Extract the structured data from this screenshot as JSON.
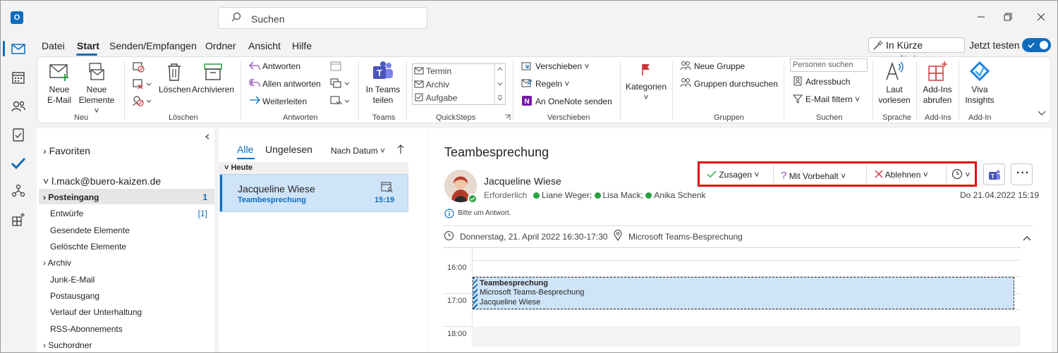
{
  "search": {
    "placeholder": "Suchen"
  },
  "menu": {
    "items": [
      "Datei",
      "Start",
      "Senden/Empfangen",
      "Ordner",
      "Ansicht",
      "Hilfe"
    ],
    "coming_soon": "In Kürze verfügbar",
    "try_now": "Jetzt testen"
  },
  "ribbon": {
    "new_email": [
      "Neue",
      "E-Mail"
    ],
    "new_items": [
      "Neue",
      "Elemente ˅"
    ],
    "group_new": "Neu",
    "delete": "Löschen",
    "archive": "Archivieren",
    "group_delete": "Löschen",
    "reply": "Antworten",
    "reply_all": "Allen antworten",
    "forward": "Weiterleiten",
    "group_reply": "Antworten",
    "teams_share": [
      "In Teams",
      "teilen"
    ],
    "group_teams": "Teams",
    "quicksteps": [
      "Termin",
      "Archiv",
      "Aufgabe"
    ],
    "group_quicksteps": "QuickSteps",
    "move": "Verschieben",
    "rules": "Regeln",
    "onenote": "An OneNote senden",
    "group_move": "Verschieben",
    "categories": "Kategorien",
    "new_group": "Neue Gruppe",
    "browse_groups": "Gruppen durchsuchen",
    "group_groups": "Gruppen",
    "people_search": "Personen suchen",
    "address_book": "Adressbuch",
    "filter_email": "E-Mail filtern",
    "group_search": "Suchen",
    "read_aloud": [
      "Laut",
      "vorlesen"
    ],
    "group_speech": "Sprache",
    "addins": [
      "Add-Ins",
      "abrufen"
    ],
    "group_addins": "Add-Ins",
    "viva": [
      "Viva",
      "Insights"
    ],
    "group_addin": "Add-In"
  },
  "folders": {
    "favorites": "Favoriten",
    "account": "l.mack@buero-kaizen.de",
    "items": [
      {
        "label": "Posteingang",
        "count": "1"
      },
      {
        "label": "Entwürfe",
        "count": "[1]"
      },
      {
        "label": "Gesendete Elemente",
        "count": ""
      },
      {
        "label": "Gelöschte Elemente",
        "count": ""
      },
      {
        "label": "Archiv",
        "count": ""
      },
      {
        "label": "Junk-E-Mail",
        "count": ""
      },
      {
        "label": "Postausgang",
        "count": ""
      },
      {
        "label": "Verlauf der Unterhaltung",
        "count": ""
      },
      {
        "label": "RSS-Abonnements",
        "count": ""
      },
      {
        "label": "Suchordner",
        "count": ""
      }
    ]
  },
  "list": {
    "tab_all": "Alle",
    "tab_unread": "Ungelesen",
    "sort": "Nach Datum",
    "group_today": "Heute",
    "message": {
      "sender": "Jacqueline Wiese",
      "subject": "Teambesprechung",
      "time": "15:19"
    }
  },
  "reading": {
    "subject": "Teambesprechung",
    "sender": "Jacqueline Wiese",
    "required": "Erforderlich",
    "attendees": [
      "Liane Weger;",
      "Lisa Mack;",
      "Anika Schenk"
    ],
    "date": "Do 21.04.2022 15:19",
    "info": "Bitte um Antwort.",
    "accept": "Zusagen",
    "tentative": "Mit Vorbehalt",
    "decline": "Ablehnen",
    "when": "Donnerstag, 21. April 2022 16:30-17:30",
    "where": "Microsoft Teams-Besprechung",
    "calendar": {
      "times": [
        "16:00",
        "17:00",
        "18:00"
      ],
      "event": [
        "Teambesprechung",
        "Microsoft Teams-Besprechung",
        "Jacqueline Wiese"
      ]
    }
  }
}
